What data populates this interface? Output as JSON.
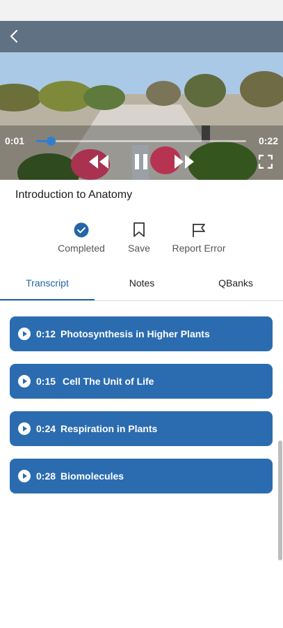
{
  "colors": {
    "accent": "#2465a8",
    "item_bg": "#2b6cb0",
    "seek": "#2f7fd1"
  },
  "video": {
    "current_time": "0:01",
    "total_time": "0:22",
    "progress": 0.07,
    "icons": [
      "back-arrow-icon",
      "rewind-icon",
      "pause-icon",
      "fast-forward-icon",
      "fullscreen-icon"
    ]
  },
  "lesson": {
    "title": "Introduction to Anatomy"
  },
  "actions": [
    {
      "label": "Completed",
      "icon": "check-circle-icon"
    },
    {
      "label": "Save",
      "icon": "bookmark-icon"
    },
    {
      "label": "Report Error",
      "icon": "flag-icon"
    }
  ],
  "tabs": [
    {
      "label": "Transcript",
      "active": true
    },
    {
      "label": "Notes",
      "active": false
    },
    {
      "label": "QBanks",
      "active": false
    }
  ],
  "transcript": [
    {
      "time": "0:12",
      "text": "Photosynthesis in Higher Plants"
    },
    {
      "time": "0:15",
      "text": "Cell The Unit of Life"
    },
    {
      "time": "0:24",
      "text": "Respiration in Plants"
    },
    {
      "time": "0:28",
      "text": "Biomolecules"
    }
  ]
}
